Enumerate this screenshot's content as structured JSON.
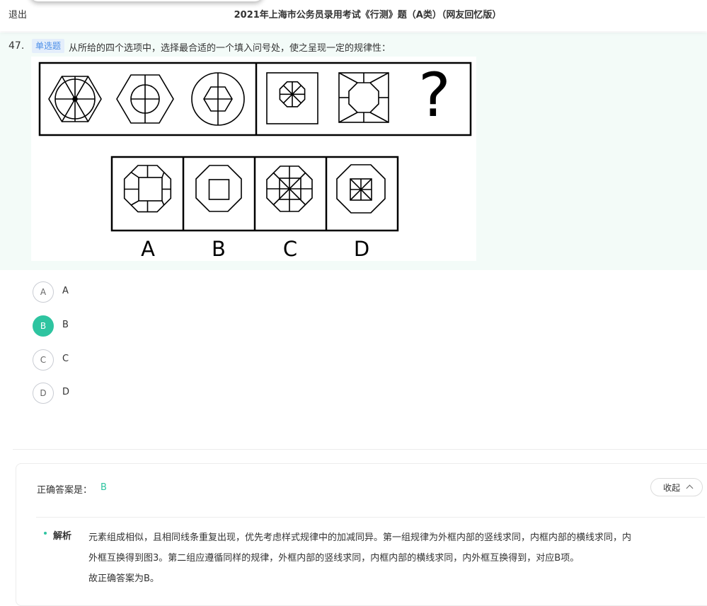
{
  "header": {
    "exit_label": "退出",
    "exam_title": "2021年上海市公务员录用考试《行测》题（A类）（网友回忆版）"
  },
  "question": {
    "number": "47.",
    "type_badge": "单选题",
    "stem": "从所给的四个选项中，选择最合适的一个填入问号处，使之呈现一定的规律性：",
    "figure": {
      "question_mark": "?",
      "option_labels": [
        "A",
        "B",
        "C",
        "D"
      ]
    }
  },
  "options": [
    {
      "letter": "A",
      "text": "A",
      "selected": false
    },
    {
      "letter": "B",
      "text": "B",
      "selected": true
    },
    {
      "letter": "C",
      "text": "C",
      "selected": false
    },
    {
      "letter": "D",
      "text": "D",
      "selected": false
    }
  ],
  "answer": {
    "label": "正确答案是：",
    "value": "B",
    "collapse_label": "收起",
    "analysis_label": "解析",
    "analysis_line1": "元素组成相似，且相同线条重复出现，优先考虑样式规律中的加减同异。第一组规律为外框内部的竖线求同，内框内部的横线求同，内",
    "analysis_line2": "外框互换得到图3。第二组应遵循同样的规律，外框内部的竖线求同，内框内部的横线求同，内外框互换得到，对应B项。",
    "analysis_line3": "故正确答案为B。"
  },
  "colors": {
    "accent": "#2ec4a0",
    "question_bg": "#f3fbf8",
    "badge_text": "#4a8ee8",
    "badge_bg": "#e4eefb"
  }
}
